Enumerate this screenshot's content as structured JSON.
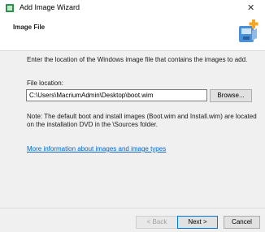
{
  "window": {
    "title": "Add Image Wizard",
    "close_glyph": "✕"
  },
  "header": {
    "title": "Image File",
    "icon": "disk-image-add-icon"
  },
  "content": {
    "instruction": "Enter the location of the Windows image file that contains the images to add.",
    "file_location_label": "File location:",
    "file_location_value": "C:\\Users\\MacriumAdmin\\Desktop\\boot.wim",
    "browse_label": "Browse...",
    "note_text": "Note: The default boot and install images (Boot.wim and Install.wim) are located on the installation DVD in the \\Sources folder.",
    "link_text": "More information about images and image types"
  },
  "footer": {
    "back_label": "< Back",
    "next_label": "Next >",
    "cancel_label": "Cancel"
  },
  "colors": {
    "link": "#0066cc",
    "focus_border": "#0078d7"
  }
}
